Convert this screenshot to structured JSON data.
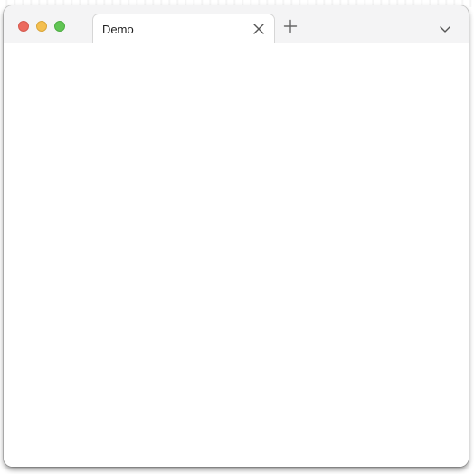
{
  "window": {
    "traffic_lights": {
      "close_color": "#ec6a5e",
      "minimize_color": "#f4bf4f",
      "maximize_color": "#61c554"
    },
    "tabs": [
      {
        "label": "Demo",
        "active": true,
        "close_icon": "close-icon"
      }
    ],
    "toolbar": {
      "new_tab_icon": "plus-icon",
      "tab_list_icon": "chevron-down-icon"
    }
  },
  "editor": {
    "text": ""
  }
}
